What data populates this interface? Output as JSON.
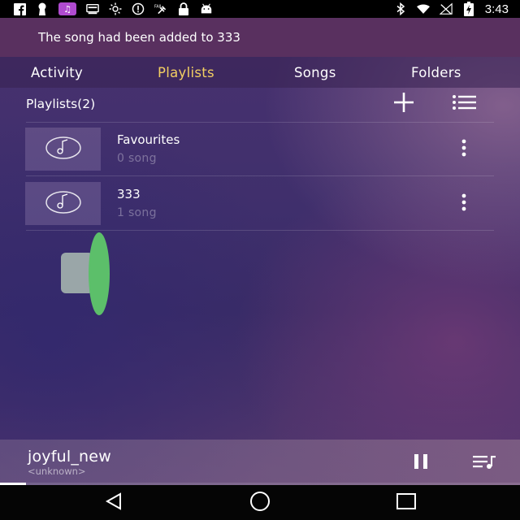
{
  "status_bar": {
    "time": "3:43",
    "left_icons": [
      "facebook-icon",
      "keyhole-icon",
      "music-note-icon",
      "cast-icon",
      "brightness-icon",
      "alert-circle-icon",
      "satellite-icon",
      "lock-icon",
      "android-icon"
    ],
    "right_icons": [
      "bluetooth-icon",
      "wifi-icon",
      "no-signal-icon",
      "battery-charging-icon"
    ]
  },
  "snackbar": {
    "message": "The song had been added to 333"
  },
  "tabs": [
    {
      "label": "Activity",
      "active": false
    },
    {
      "label": "Playlists",
      "active": true
    },
    {
      "label": "Songs",
      "active": false
    },
    {
      "label": "Folders",
      "active": false
    }
  ],
  "playlists_header": {
    "title": "Playlists(2)"
  },
  "playlists": [
    {
      "name": "Favourites",
      "count": "0 song"
    },
    {
      "name": "333",
      "count": "1 song"
    }
  ],
  "now_playing": {
    "title": "joyful_new",
    "artist": "<unknown>",
    "progress_fraction": 0.05
  },
  "colors": {
    "accent_tab": "#f3cf62",
    "snackbar_bg": "#59305f",
    "bubble_green": "#5cbf6a"
  }
}
